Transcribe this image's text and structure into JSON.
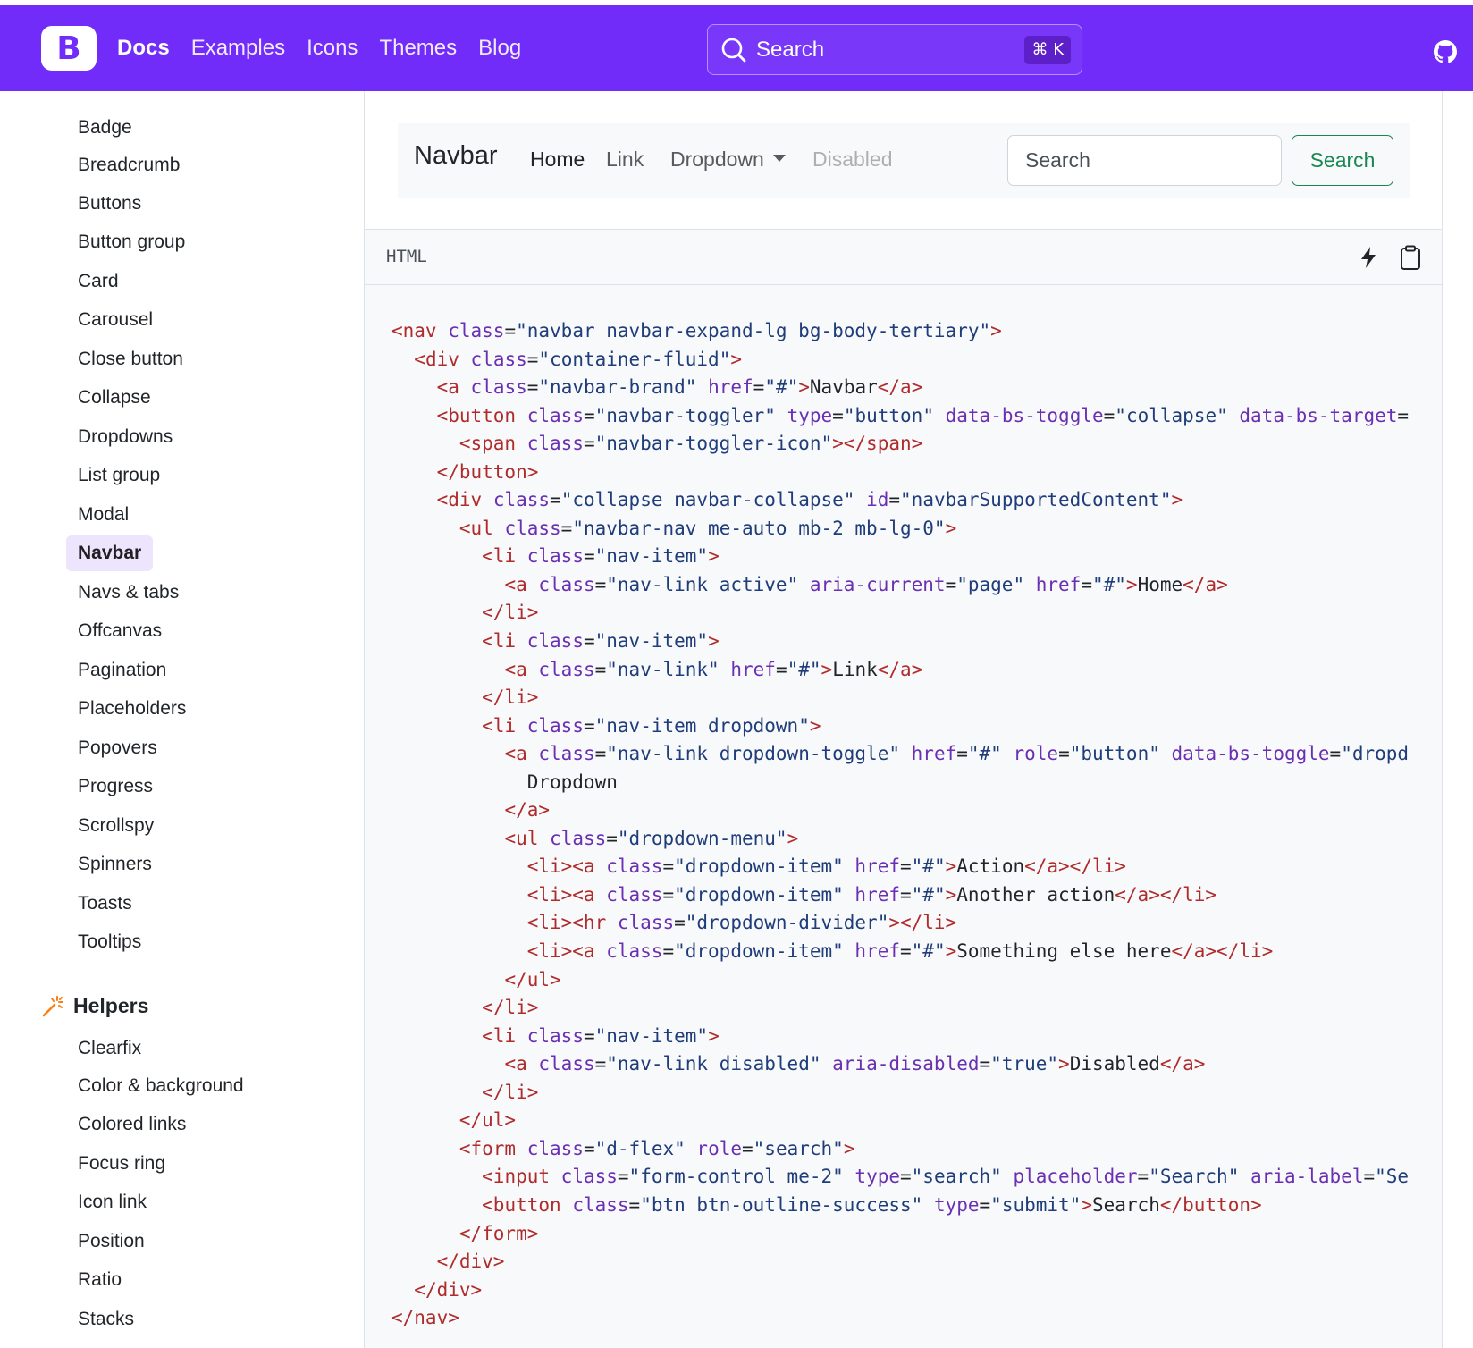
{
  "topbar": {
    "logo": "B",
    "nav": [
      {
        "label": "Docs",
        "active": true
      },
      {
        "label": "Examples"
      },
      {
        "label": "Icons"
      },
      {
        "label": "Themes"
      },
      {
        "label": "Blog"
      }
    ],
    "search_label": "Search",
    "search_shortcut": "⌘ K",
    "icons": [
      "search-icon",
      "github-icon"
    ],
    "accent_color": "#712cf9"
  },
  "sidebar": {
    "items": [
      "Badge",
      "Breadcrumb",
      "Buttons",
      "Button group",
      "Card",
      "Carousel",
      "Close button",
      "Collapse",
      "Dropdowns",
      "List group",
      "Modal",
      "Navbar",
      "Navs & tabs",
      "Offcanvas",
      "Pagination",
      "Placeholders",
      "Popovers",
      "Progress",
      "Scrollspy",
      "Spinners",
      "Toasts",
      "Tooltips"
    ],
    "active_item": "Navbar",
    "helpers_heading": "Helpers",
    "helpers_items": [
      "Clearfix",
      "Color & background",
      "Colored links",
      "Focus ring",
      "Icon link",
      "Position",
      "Ratio",
      "Stacks"
    ]
  },
  "example": {
    "brand": "Navbar",
    "links": [
      "Home",
      "Link",
      "Dropdown",
      "Disabled"
    ],
    "search_placeholder": "Search",
    "search_button": "Search",
    "button_color": "#198754"
  },
  "code": {
    "language": "HTML",
    "lines": [
      [
        [
          "t",
          "<nav"
        ],
        [
          "p",
          " "
        ],
        [
          "a",
          "class"
        ],
        [
          "p",
          "="
        ],
        [
          "s",
          "\"navbar navbar-expand-lg bg-body-tertiary\""
        ],
        [
          "t",
          ">"
        ]
      ],
      [
        [
          "p",
          "  "
        ],
        [
          "t",
          "<div"
        ],
        [
          "p",
          " "
        ],
        [
          "a",
          "class"
        ],
        [
          "p",
          "="
        ],
        [
          "s",
          "\"container-fluid\""
        ],
        [
          "t",
          ">"
        ]
      ],
      [
        [
          "p",
          "    "
        ],
        [
          "t",
          "<a"
        ],
        [
          "p",
          " "
        ],
        [
          "a",
          "class"
        ],
        [
          "p",
          "="
        ],
        [
          "s",
          "\"navbar-brand\""
        ],
        [
          "p",
          " "
        ],
        [
          "a",
          "href"
        ],
        [
          "p",
          "="
        ],
        [
          "s",
          "\"#\""
        ],
        [
          "t",
          ">"
        ],
        [
          "p",
          "Navbar"
        ],
        [
          "t",
          "</a>"
        ]
      ],
      [
        [
          "p",
          "    "
        ],
        [
          "t",
          "<button"
        ],
        [
          "p",
          " "
        ],
        [
          "a",
          "class"
        ],
        [
          "p",
          "="
        ],
        [
          "s",
          "\"navbar-toggler\""
        ],
        [
          "p",
          " "
        ],
        [
          "a",
          "type"
        ],
        [
          "p",
          "="
        ],
        [
          "s",
          "\"button\""
        ],
        [
          "p",
          " "
        ],
        [
          "a",
          "data-bs-toggle"
        ],
        [
          "p",
          "="
        ],
        [
          "s",
          "\"collapse\""
        ],
        [
          "p",
          " "
        ],
        [
          "a",
          "data-bs-target"
        ],
        [
          "p",
          "="
        ],
        [
          "s",
          "'"
        ]
      ],
      [
        [
          "p",
          "      "
        ],
        [
          "t",
          "<span"
        ],
        [
          "p",
          " "
        ],
        [
          "a",
          "class"
        ],
        [
          "p",
          "="
        ],
        [
          "s",
          "\"navbar-toggler-icon\""
        ],
        [
          "t",
          "></span>"
        ]
      ],
      [
        [
          "p",
          "    "
        ],
        [
          "t",
          "</button>"
        ]
      ],
      [
        [
          "p",
          "    "
        ],
        [
          "t",
          "<div"
        ],
        [
          "p",
          " "
        ],
        [
          "a",
          "class"
        ],
        [
          "p",
          "="
        ],
        [
          "s",
          "\"collapse navbar-collapse\""
        ],
        [
          "p",
          " "
        ],
        [
          "a",
          "id"
        ],
        [
          "p",
          "="
        ],
        [
          "s",
          "\"navbarSupportedContent\""
        ],
        [
          "t",
          ">"
        ]
      ],
      [
        [
          "p",
          "      "
        ],
        [
          "t",
          "<ul"
        ],
        [
          "p",
          " "
        ],
        [
          "a",
          "class"
        ],
        [
          "p",
          "="
        ],
        [
          "s",
          "\"navbar-nav me-auto mb-2 mb-lg-0\""
        ],
        [
          "t",
          ">"
        ]
      ],
      [
        [
          "p",
          "        "
        ],
        [
          "t",
          "<li"
        ],
        [
          "p",
          " "
        ],
        [
          "a",
          "class"
        ],
        [
          "p",
          "="
        ],
        [
          "s",
          "\"nav-item\""
        ],
        [
          "t",
          ">"
        ]
      ],
      [
        [
          "p",
          "          "
        ],
        [
          "t",
          "<a"
        ],
        [
          "p",
          " "
        ],
        [
          "a",
          "class"
        ],
        [
          "p",
          "="
        ],
        [
          "s",
          "\"nav-link active\""
        ],
        [
          "p",
          " "
        ],
        [
          "a",
          "aria-current"
        ],
        [
          "p",
          "="
        ],
        [
          "s",
          "\"page\""
        ],
        [
          "p",
          " "
        ],
        [
          "a",
          "href"
        ],
        [
          "p",
          "="
        ],
        [
          "s",
          "\"#\""
        ],
        [
          "t",
          ">"
        ],
        [
          "p",
          "Home"
        ],
        [
          "t",
          "</a>"
        ]
      ],
      [
        [
          "p",
          "        "
        ],
        [
          "t",
          "</li>"
        ]
      ],
      [
        [
          "p",
          "        "
        ],
        [
          "t",
          "<li"
        ],
        [
          "p",
          " "
        ],
        [
          "a",
          "class"
        ],
        [
          "p",
          "="
        ],
        [
          "s",
          "\"nav-item\""
        ],
        [
          "t",
          ">"
        ]
      ],
      [
        [
          "p",
          "          "
        ],
        [
          "t",
          "<a"
        ],
        [
          "p",
          " "
        ],
        [
          "a",
          "class"
        ],
        [
          "p",
          "="
        ],
        [
          "s",
          "\"nav-link\""
        ],
        [
          "p",
          " "
        ],
        [
          "a",
          "href"
        ],
        [
          "p",
          "="
        ],
        [
          "s",
          "\"#\""
        ],
        [
          "t",
          ">"
        ],
        [
          "p",
          "Link"
        ],
        [
          "t",
          "</a>"
        ]
      ],
      [
        [
          "p",
          "        "
        ],
        [
          "t",
          "</li>"
        ]
      ],
      [
        [
          "p",
          "        "
        ],
        [
          "t",
          "<li"
        ],
        [
          "p",
          " "
        ],
        [
          "a",
          "class"
        ],
        [
          "p",
          "="
        ],
        [
          "s",
          "\"nav-item dropdown\""
        ],
        [
          "t",
          ">"
        ]
      ],
      [
        [
          "p",
          "          "
        ],
        [
          "t",
          "<a"
        ],
        [
          "p",
          " "
        ],
        [
          "a",
          "class"
        ],
        [
          "p",
          "="
        ],
        [
          "s",
          "\"nav-link dropdown-toggle\""
        ],
        [
          "p",
          " "
        ],
        [
          "a",
          "href"
        ],
        [
          "p",
          "="
        ],
        [
          "s",
          "\"#\""
        ],
        [
          "p",
          " "
        ],
        [
          "a",
          "role"
        ],
        [
          "p",
          "="
        ],
        [
          "s",
          "\"button\""
        ],
        [
          "p",
          " "
        ],
        [
          "a",
          "data-bs-toggle"
        ],
        [
          "p",
          "="
        ],
        [
          "s",
          "\"dropdc"
        ]
      ],
      [
        [
          "p",
          "            Dropdown"
        ]
      ],
      [
        [
          "p",
          "          "
        ],
        [
          "t",
          "</a>"
        ]
      ],
      [
        [
          "p",
          "          "
        ],
        [
          "t",
          "<ul"
        ],
        [
          "p",
          " "
        ],
        [
          "a",
          "class"
        ],
        [
          "p",
          "="
        ],
        [
          "s",
          "\"dropdown-menu\""
        ],
        [
          "t",
          ">"
        ]
      ],
      [
        [
          "p",
          "            "
        ],
        [
          "t",
          "<li><a"
        ],
        [
          "p",
          " "
        ],
        [
          "a",
          "class"
        ],
        [
          "p",
          "="
        ],
        [
          "s",
          "\"dropdown-item\""
        ],
        [
          "p",
          " "
        ],
        [
          "a",
          "href"
        ],
        [
          "p",
          "="
        ],
        [
          "s",
          "\"#\""
        ],
        [
          "t",
          ">"
        ],
        [
          "p",
          "Action"
        ],
        [
          "t",
          "</a></li>"
        ]
      ],
      [
        [
          "p",
          "            "
        ],
        [
          "t",
          "<li><a"
        ],
        [
          "p",
          " "
        ],
        [
          "a",
          "class"
        ],
        [
          "p",
          "="
        ],
        [
          "s",
          "\"dropdown-item\""
        ],
        [
          "p",
          " "
        ],
        [
          "a",
          "href"
        ],
        [
          "p",
          "="
        ],
        [
          "s",
          "\"#\""
        ],
        [
          "t",
          ">"
        ],
        [
          "p",
          "Another action"
        ],
        [
          "t",
          "</a></li>"
        ]
      ],
      [
        [
          "p",
          "            "
        ],
        [
          "t",
          "<li><hr"
        ],
        [
          "p",
          " "
        ],
        [
          "a",
          "class"
        ],
        [
          "p",
          "="
        ],
        [
          "s",
          "\"dropdown-divider\""
        ],
        [
          "t",
          "></li>"
        ]
      ],
      [
        [
          "p",
          "            "
        ],
        [
          "t",
          "<li><a"
        ],
        [
          "p",
          " "
        ],
        [
          "a",
          "class"
        ],
        [
          "p",
          "="
        ],
        [
          "s",
          "\"dropdown-item\""
        ],
        [
          "p",
          " "
        ],
        [
          "a",
          "href"
        ],
        [
          "p",
          "="
        ],
        [
          "s",
          "\"#\""
        ],
        [
          "t",
          ">"
        ],
        [
          "p",
          "Something else here"
        ],
        [
          "t",
          "</a></li>"
        ]
      ],
      [
        [
          "p",
          "          "
        ],
        [
          "t",
          "</ul>"
        ]
      ],
      [
        [
          "p",
          "        "
        ],
        [
          "t",
          "</li>"
        ]
      ],
      [
        [
          "p",
          "        "
        ],
        [
          "t",
          "<li"
        ],
        [
          "p",
          " "
        ],
        [
          "a",
          "class"
        ],
        [
          "p",
          "="
        ],
        [
          "s",
          "\"nav-item\""
        ],
        [
          "t",
          ">"
        ]
      ],
      [
        [
          "p",
          "          "
        ],
        [
          "t",
          "<a"
        ],
        [
          "p",
          " "
        ],
        [
          "a",
          "class"
        ],
        [
          "p",
          "="
        ],
        [
          "s",
          "\"nav-link disabled\""
        ],
        [
          "p",
          " "
        ],
        [
          "a",
          "aria-disabled"
        ],
        [
          "p",
          "="
        ],
        [
          "s",
          "\"true\""
        ],
        [
          "t",
          ">"
        ],
        [
          "p",
          "Disabled"
        ],
        [
          "t",
          "</a>"
        ]
      ],
      [
        [
          "p",
          "        "
        ],
        [
          "t",
          "</li>"
        ]
      ],
      [
        [
          "p",
          "      "
        ],
        [
          "t",
          "</ul>"
        ]
      ],
      [
        [
          "p",
          "      "
        ],
        [
          "t",
          "<form"
        ],
        [
          "p",
          " "
        ],
        [
          "a",
          "class"
        ],
        [
          "p",
          "="
        ],
        [
          "s",
          "\"d-flex\""
        ],
        [
          "p",
          " "
        ],
        [
          "a",
          "role"
        ],
        [
          "p",
          "="
        ],
        [
          "s",
          "\"search\""
        ],
        [
          "t",
          ">"
        ]
      ],
      [
        [
          "p",
          "        "
        ],
        [
          "t",
          "<input"
        ],
        [
          "p",
          " "
        ],
        [
          "a",
          "class"
        ],
        [
          "p",
          "="
        ],
        [
          "s",
          "\"form-control me-2\""
        ],
        [
          "p",
          " "
        ],
        [
          "a",
          "type"
        ],
        [
          "p",
          "="
        ],
        [
          "s",
          "\"search\""
        ],
        [
          "p",
          " "
        ],
        [
          "a",
          "placeholder"
        ],
        [
          "p",
          "="
        ],
        [
          "s",
          "\"Search\""
        ],
        [
          "p",
          " "
        ],
        [
          "a",
          "aria-label"
        ],
        [
          "p",
          "="
        ],
        [
          "s",
          "\"Sea"
        ]
      ],
      [
        [
          "p",
          "        "
        ],
        [
          "t",
          "<button"
        ],
        [
          "p",
          " "
        ],
        [
          "a",
          "class"
        ],
        [
          "p",
          "="
        ],
        [
          "s",
          "\"btn btn-outline-success\""
        ],
        [
          "p",
          " "
        ],
        [
          "a",
          "type"
        ],
        [
          "p",
          "="
        ],
        [
          "s",
          "\"submit\""
        ],
        [
          "t",
          ">"
        ],
        [
          "p",
          "Search"
        ],
        [
          "t",
          "</button>"
        ]
      ],
      [
        [
          "p",
          "      "
        ],
        [
          "t",
          "</form>"
        ]
      ],
      [
        [
          "p",
          "    "
        ],
        [
          "t",
          "</div>"
        ]
      ],
      [
        [
          "p",
          "  "
        ],
        [
          "t",
          "</div>"
        ]
      ],
      [
        [
          "t",
          "</nav>"
        ]
      ]
    ]
  }
}
